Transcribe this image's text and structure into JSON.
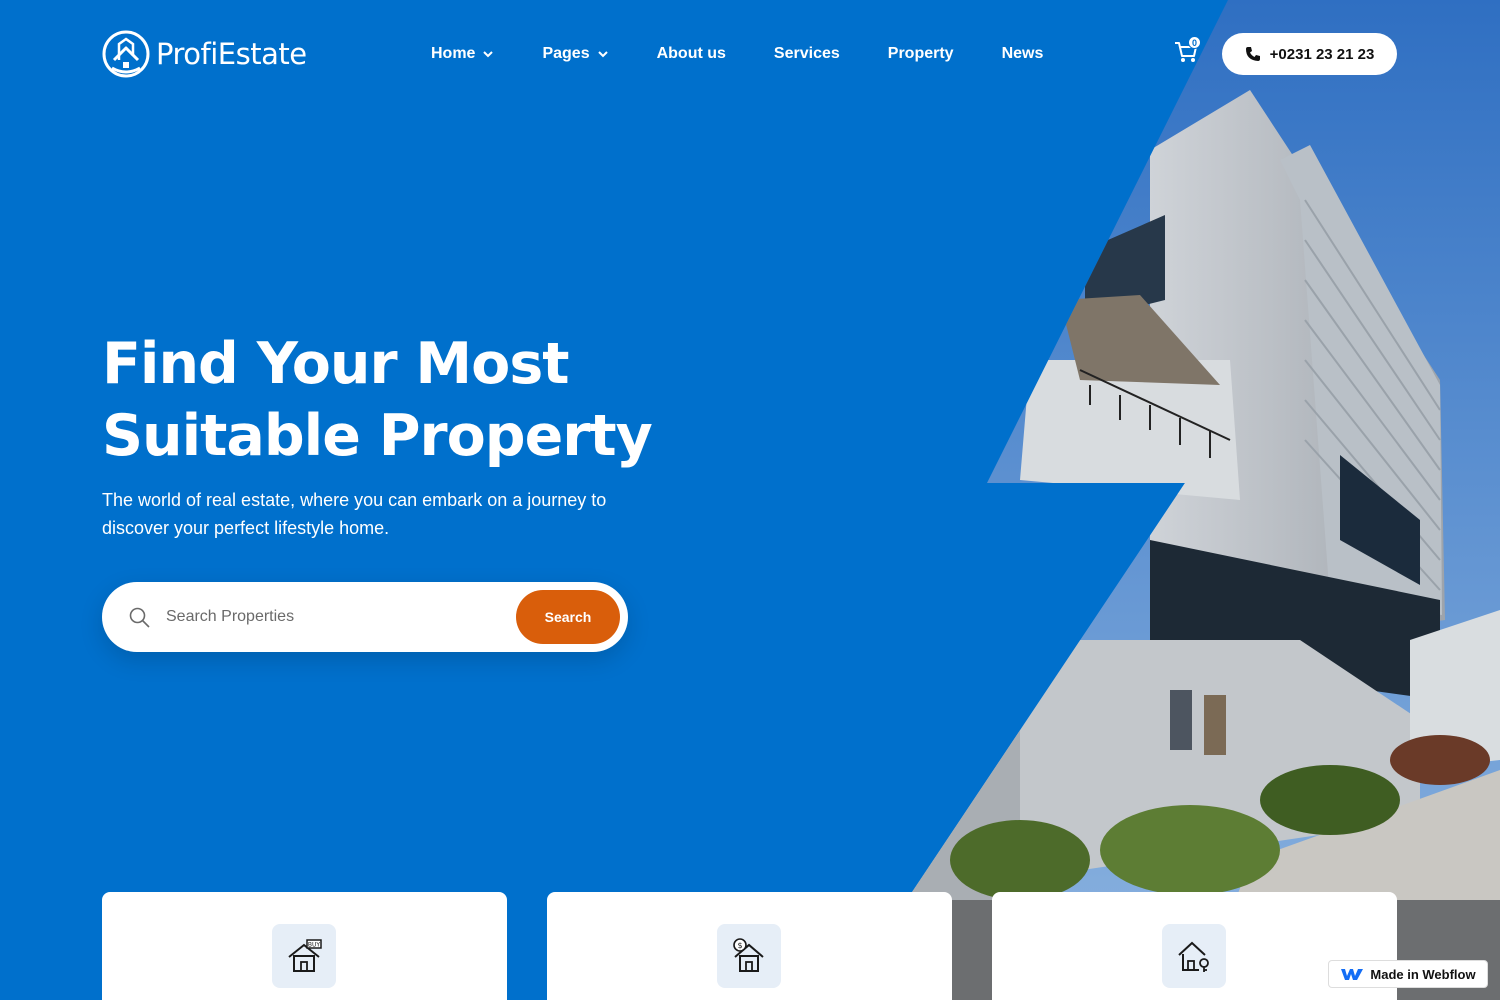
{
  "brand": {
    "name": "ProfiEstate",
    "accent": "#0070cc",
    "cta": "#d95e0b"
  },
  "nav": {
    "items": [
      {
        "label": "Home",
        "dropdown": true
      },
      {
        "label": "Pages",
        "dropdown": true
      },
      {
        "label": "About us",
        "dropdown": false
      },
      {
        "label": "Services",
        "dropdown": false
      },
      {
        "label": "Property",
        "dropdown": false
      },
      {
        "label": "News",
        "dropdown": false
      }
    ]
  },
  "cart": {
    "count": "0",
    "icon": "cart-icon"
  },
  "phone": {
    "label": "+0231 23 21 23",
    "icon": "phone-icon"
  },
  "hero": {
    "title_line1": "Find Your Most",
    "title_line2": "Suitable Property",
    "subtitle": "The world of real estate, where you can embark on a journey to discover your perfect lifestyle home."
  },
  "search": {
    "placeholder": "Search Properties",
    "value": "",
    "button_label": "Search"
  },
  "cards": [
    {
      "icon": "buy-house-icon"
    },
    {
      "icon": "house-price-icon"
    },
    {
      "icon": "house-key-icon"
    }
  ],
  "badge": {
    "label": "Made in Webflow"
  }
}
